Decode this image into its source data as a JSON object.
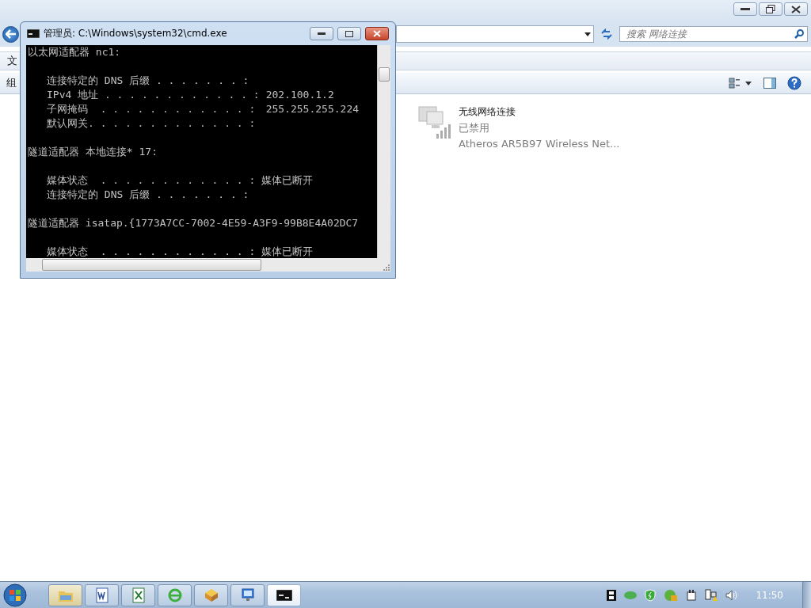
{
  "explorer": {
    "search": {
      "placeholder": "搜索 网络连接"
    },
    "menu_bar": {
      "items": [
        "文"
      ]
    },
    "toolbar": {
      "items": [
        "组"
      ]
    },
    "connections": [
      {
        "name": "无线网络连接",
        "status": "已禁用",
        "device": "Atheros AR5B97 Wireless Net...",
        "disabled": true
      }
    ]
  },
  "cmd": {
    "title": "管理员: C:\\Windows\\system32\\cmd.exe",
    "sections": [
      {
        "heading": "以太网适配器 nc1:",
        "entries": [
          {
            "label": "连接特定的 DNS 后缀 . . . . . . . :"
          },
          {
            "label": "IPv4 地址 . . . . . . . . . . . . :",
            "value": "202.100.1.2"
          },
          {
            "label": "子网掩码  . . . . . . . . . . . . :",
            "value": "255.255.255.224"
          },
          {
            "label": "默认网关. . . . . . . . . . . . . :"
          }
        ]
      },
      {
        "heading": "隧道适配器 本地连接* 17:",
        "entries": [
          {
            "label": "媒体状态  . . . . . . . . . . . . :",
            "value": "媒体已断开"
          },
          {
            "label": "连接特定的 DNS 后缀 . . . . . . . :"
          }
        ]
      },
      {
        "heading": "隧道适配器 isatap.{1773A7CC-7002-4E59-A3F9-99B8E4A02DC7",
        "entries": [
          {
            "label": "媒体状态  . . . . . . . . . . . . :",
            "value": "媒体已断开"
          }
        ]
      }
    ]
  },
  "taskbar": {
    "apps": [
      {
        "kind": "folder",
        "selected": false,
        "highlighted": true
      },
      {
        "kind": "word",
        "selected": false,
        "highlighted": false
      },
      {
        "kind": "excel",
        "selected": false,
        "highlighted": false
      },
      {
        "kind": "browser",
        "selected": false,
        "highlighted": false
      },
      {
        "kind": "cube",
        "selected": false,
        "highlighted": false
      },
      {
        "kind": "monitor",
        "selected": false,
        "highlighted": false
      },
      {
        "kind": "console",
        "selected": true,
        "highlighted": false
      }
    ],
    "tray": [
      {
        "kind": "film"
      },
      {
        "kind": "blob"
      },
      {
        "kind": "shield"
      },
      {
        "kind": "globe"
      },
      {
        "kind": "plug"
      },
      {
        "kind": "network"
      },
      {
        "kind": "speaker"
      }
    ],
    "clock": "11:50"
  }
}
